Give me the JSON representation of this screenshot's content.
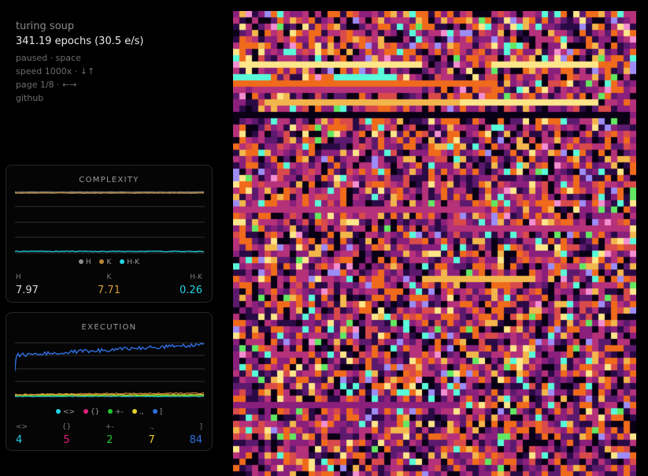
{
  "header": {
    "title": "turing soup",
    "epochs": "341.19 epochs (30.5 e/s)",
    "status": "paused · space",
    "speed": "speed 1000x · ↓↑",
    "page": "page 1/8 · ←→",
    "link": "github"
  },
  "complexity": {
    "title": "COMPLEXITY",
    "legend": [
      {
        "label": "H",
        "color": "#8c8c8c"
      },
      {
        "label": "K",
        "color": "#b5843a"
      },
      {
        "label": "H-K",
        "color": "#22d3e6"
      }
    ],
    "stats": [
      {
        "label": "H",
        "value": "7.97",
        "color": "#d8d8d8"
      },
      {
        "label": "K",
        "value": "7.71",
        "color": "#d39a3c"
      },
      {
        "label": "H-K",
        "value": "0.26",
        "color": "#22d3e6"
      }
    ]
  },
  "execution": {
    "title": "EXECUTION",
    "legend": [
      {
        "label": "<>",
        "color": "#22d3e6"
      },
      {
        "label": "{}",
        "color": "#e0207f"
      },
      {
        "label": "+-",
        "color": "#22c532"
      },
      {
        "label": ".,",
        "color": "#e3d12c"
      },
      {
        "label": "]",
        "color": "#2f6fe0"
      }
    ],
    "stats": [
      {
        "label": "<>",
        "value": "4",
        "color": "#22d3e6"
      },
      {
        "label": "{}",
        "value": "5",
        "color": "#e0207f"
      },
      {
        "label": "+-",
        "value": "2",
        "color": "#22c532"
      },
      {
        "label": ".,",
        "value": "7",
        "color": "#e3d12c"
      },
      {
        "label": "]",
        "value": "84",
        "color": "#2f6fe0"
      }
    ]
  },
  "soup_palette": [
    "#0a0015",
    "#2a0a45",
    "#5c1a6e",
    "#8a1f7c",
    "#b5317a",
    "#d94a4a",
    "#f06a1c",
    "#f2b64c",
    "#fde68a",
    "#58fcd9",
    "#9d8cf5",
    "#62e862",
    "#f38fd0"
  ]
}
